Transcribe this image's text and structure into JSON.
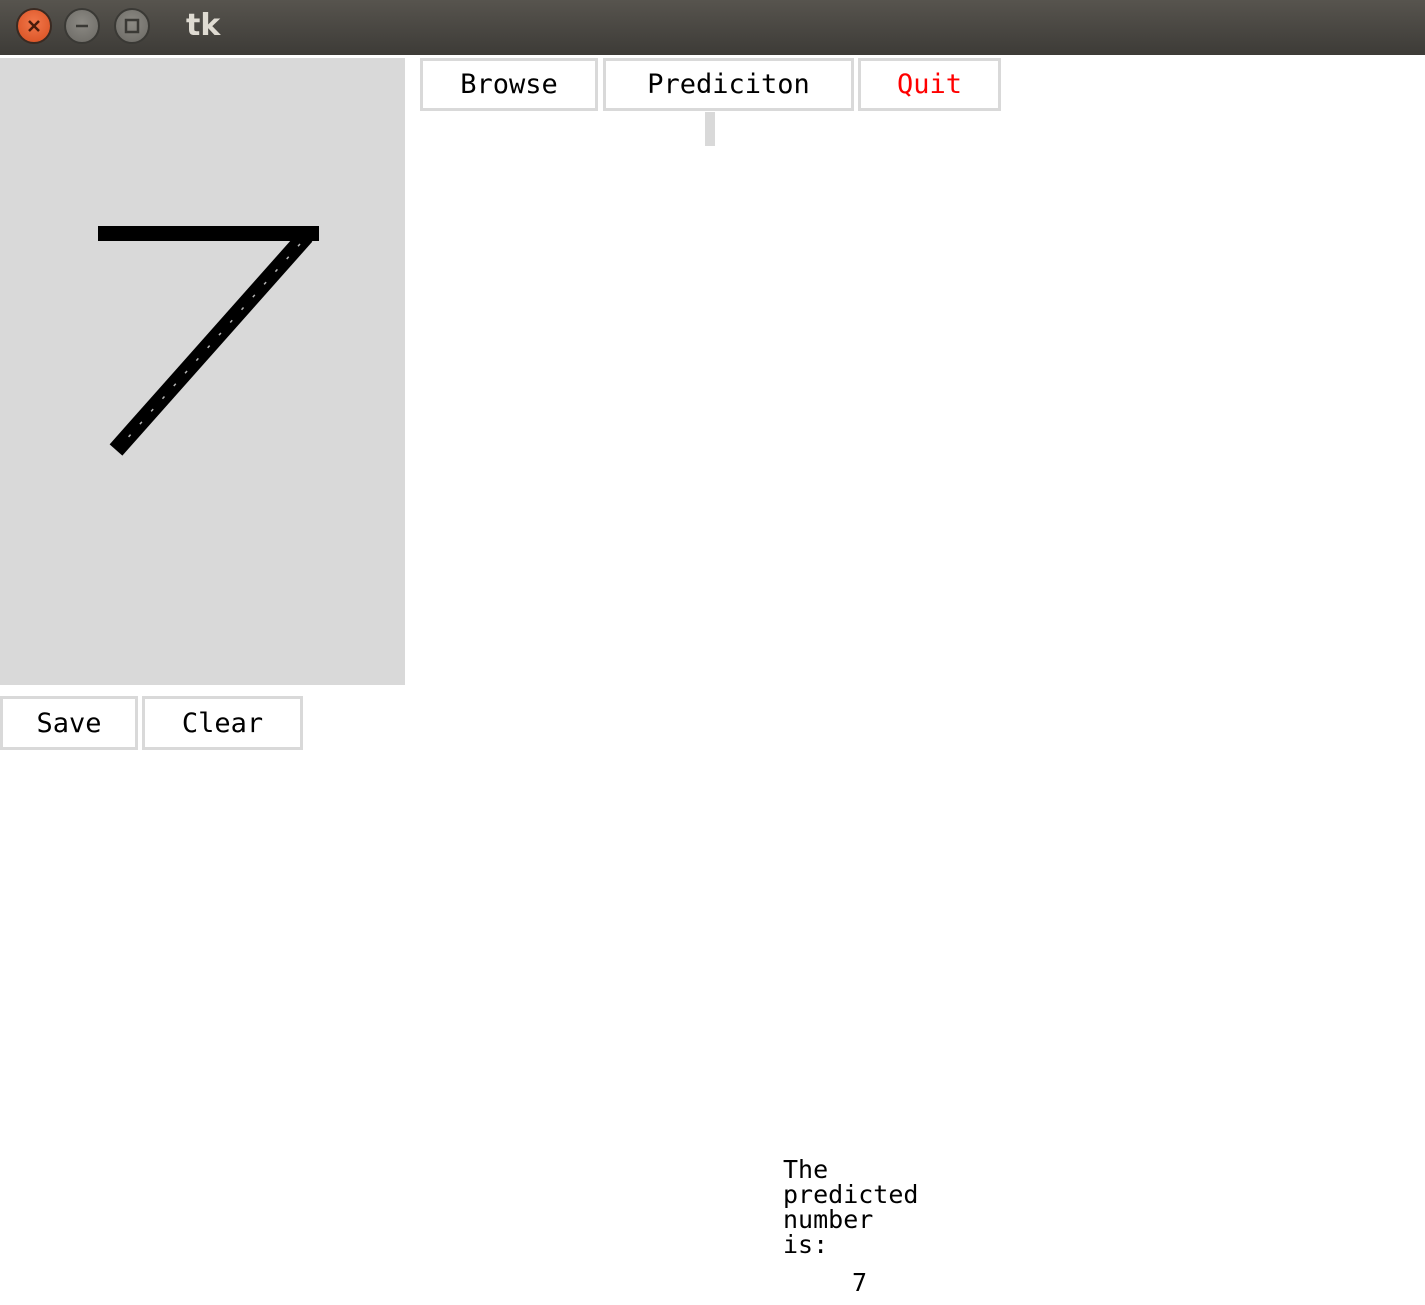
{
  "window": {
    "title": "tk",
    "controls": [
      "close-icon",
      "minimize-icon",
      "maximize-icon"
    ]
  },
  "toolbar": {
    "browse_label": "Browse",
    "prediction_label": "Prediciton",
    "quit_label": "Quit"
  },
  "canvas": {
    "drawn_digit": "7",
    "background": "#d9d9d9",
    "stroke_color": "#000000"
  },
  "canvas_buttons": {
    "save_label": "Save",
    "clear_label": "Clear"
  },
  "result": {
    "label_lines": [
      "The",
      "predicted",
      "number",
      "is:"
    ],
    "value": "7"
  },
  "colors": {
    "quit_text": "#ff0000",
    "titlebar": "#4a4844",
    "close_button": "#e8602f"
  }
}
